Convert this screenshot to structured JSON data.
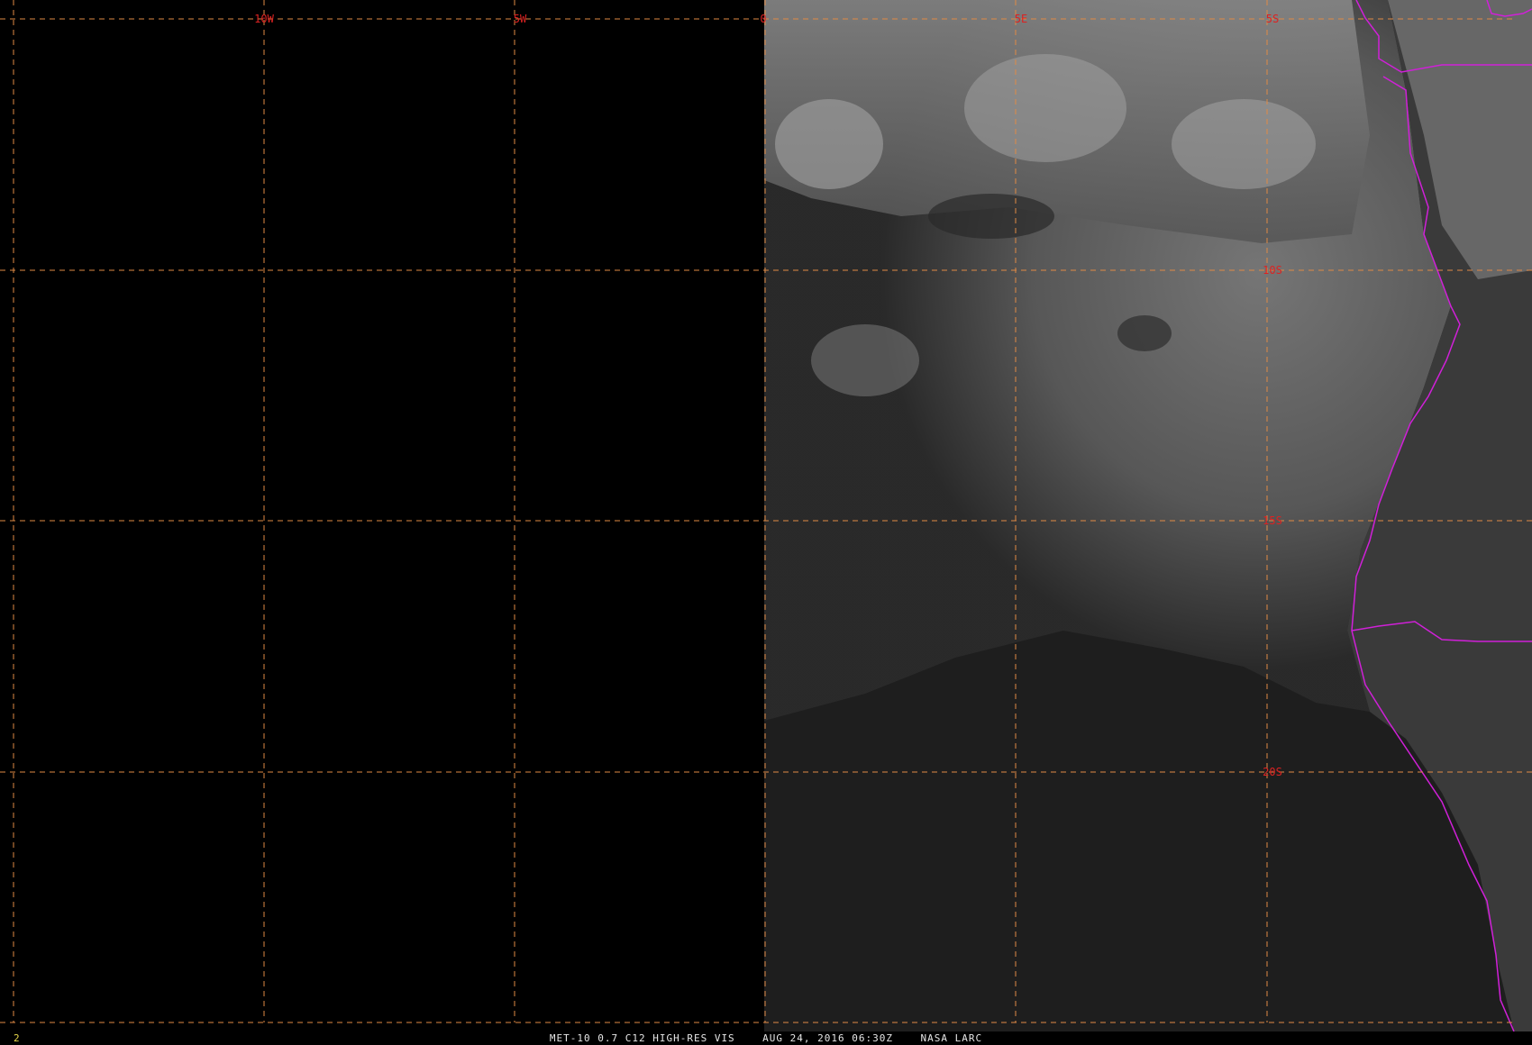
{
  "map": {
    "longitude_labels": [
      "10W",
      "5W",
      "0",
      "5E",
      "5S"
    ],
    "latitude_labels": [
      "10S",
      "15S",
      "20S"
    ],
    "colors": {
      "space_no_data": "#000000",
      "ocean_clear": "#1e1e1e",
      "cloud_deck": "#6f6f6f",
      "land": "#3a3a3a",
      "grid_line": "#e08a45",
      "grid_label": "#dd2222",
      "coastline": "#d020d8"
    }
  },
  "footer": {
    "frame_number": "2",
    "caption": "MET-10 0.7 C12 HIGH-RES VIS    AUG 24, 2016 06:30Z    NASA LARC"
  }
}
